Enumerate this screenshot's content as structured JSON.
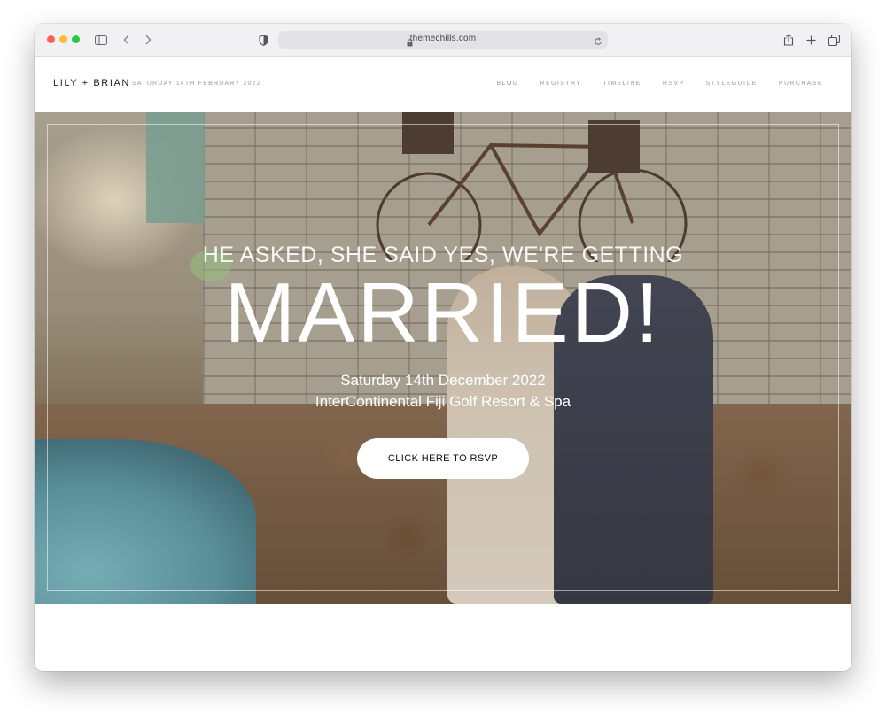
{
  "browser": {
    "url": "themechills.com",
    "traffic_lights": [
      "#ff5f57",
      "#febc2e",
      "#28c840"
    ],
    "icons": [
      "sidebar-icon",
      "back-chevron-icon",
      "forward-chevron-icon",
      "shield-icon",
      "lock-icon",
      "reload-icon",
      "share-icon",
      "plus-icon",
      "tabs-icon"
    ]
  },
  "header": {
    "brand": "LILY + BRIAN",
    "brand_date": "SATURDAY 14TH FEBRUARY 2022",
    "nav": [
      "BLOG",
      "REGISTRY",
      "TIMELINE",
      "RSVP",
      "STYLEGUIDE",
      "PURCHASE"
    ]
  },
  "hero": {
    "kicker": "HE ASKED, SHE SAID YES, WE'RE GETTING",
    "title": "MARRIED!",
    "date": "Saturday 14th December 2022",
    "venue": "InterContinental Fiji Golf Resort & Spa",
    "cta": "CLICK HERE TO RSVP"
  }
}
